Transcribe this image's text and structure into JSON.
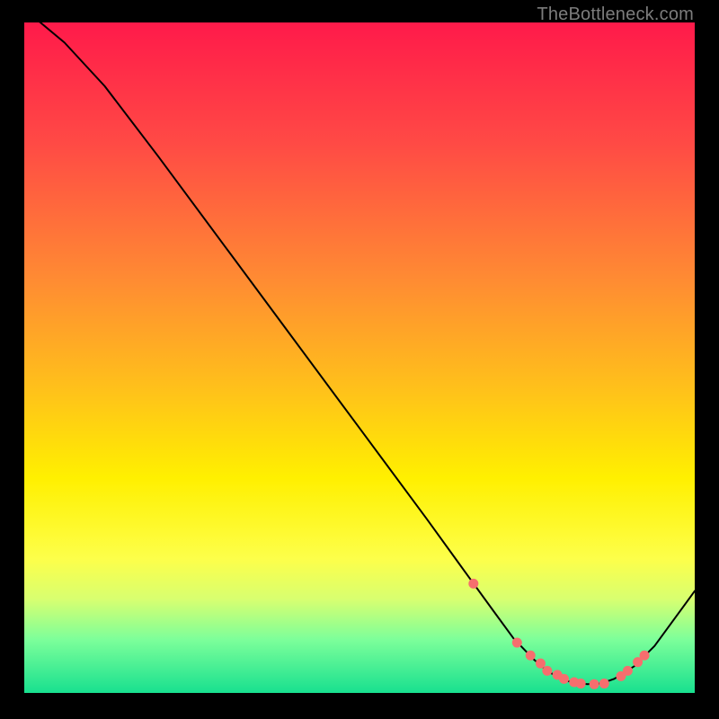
{
  "watermark": "TheBottleneck.com",
  "chart_data": {
    "type": "line",
    "title": "",
    "xlabel": "",
    "ylabel": "",
    "xlim": [
      0,
      100
    ],
    "ylim": [
      0,
      100
    ],
    "background_gradient": {
      "stops": [
        {
          "offset": 0,
          "color": "#ff1a4a"
        },
        {
          "offset": 18,
          "color": "#ff4a45"
        },
        {
          "offset": 38,
          "color": "#ff8a33"
        },
        {
          "offset": 55,
          "color": "#ffc21a"
        },
        {
          "offset": 68,
          "color": "#fff000"
        },
        {
          "offset": 80,
          "color": "#fdff4a"
        },
        {
          "offset": 86,
          "color": "#d8ff70"
        },
        {
          "offset": 92,
          "color": "#7dff9a"
        },
        {
          "offset": 100,
          "color": "#18e08f"
        }
      ]
    },
    "series": [
      {
        "name": "bottleneck-curve",
        "type": "line",
        "x": [
          0,
          6,
          12,
          20,
          30,
          40,
          50,
          60,
          66,
          70,
          73,
          76,
          78,
          80,
          82,
          84,
          86,
          88,
          91,
          94,
          100
        ],
        "values": [
          102,
          97,
          90.5,
          80,
          66.5,
          53,
          39.5,
          26,
          17.7,
          12.2,
          8.1,
          5.0,
          3.3,
          2.1,
          1.5,
          1.3,
          1.4,
          2.1,
          4.0,
          7.0,
          15.2
        ]
      },
      {
        "name": "marker-dots",
        "type": "scatter",
        "color": "#f66e6e",
        "x": [
          67,
          73.5,
          75.5,
          77,
          78,
          79.5,
          80.5,
          82,
          83,
          85,
          86.5,
          89,
          90,
          91.5,
          92.5
        ],
        "values": [
          16.3,
          7.5,
          5.6,
          4.4,
          3.3,
          2.7,
          2.1,
          1.6,
          1.4,
          1.3,
          1.4,
          2.5,
          3.3,
          4.6,
          5.6
        ]
      }
    ]
  }
}
